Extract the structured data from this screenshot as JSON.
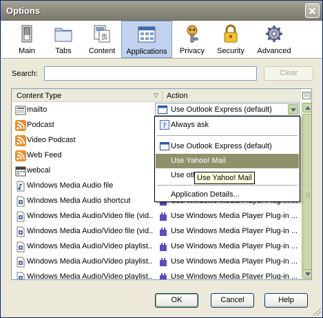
{
  "window": {
    "title": "Options"
  },
  "toolbar": {
    "items": [
      {
        "label": "Main",
        "icon": "switch-icon"
      },
      {
        "label": "Tabs",
        "icon": "folder-tabs-icon"
      },
      {
        "label": "Content",
        "icon": "content-icon"
      },
      {
        "label": "Applications",
        "icon": "applications-icon",
        "selected": true
      },
      {
        "label": "Privacy",
        "icon": "mask-icon"
      },
      {
        "label": "Security",
        "icon": "padlock-icon"
      },
      {
        "label": "Advanced",
        "icon": "gear-icon"
      }
    ]
  },
  "search": {
    "label": "Search:",
    "value": "",
    "clear_label": "Clear"
  },
  "table": {
    "columns": {
      "type": "Content Type",
      "action": "Action"
    },
    "rows": [
      {
        "type": "mailto",
        "icon": "mail-icon",
        "action": "Use Outlook Express (default)"
      },
      {
        "type": "Podcast",
        "icon": "feed-icon",
        "action": ""
      },
      {
        "type": "Video Podcast",
        "icon": "feed-icon",
        "action": ""
      },
      {
        "type": "Web Feed",
        "icon": "feed-icon",
        "action": ""
      },
      {
        "type": "webcal",
        "icon": "calendar-icon",
        "action": ""
      },
      {
        "type": "Windows Media Audio file",
        "icon": "audio-file-icon",
        "action": ""
      },
      {
        "type": "Windows Media Audio shortcut",
        "icon": "media-file-icon",
        "action": "Use Windows Media Player Plug-in ..."
      },
      {
        "type": "Windows Media Audio/Video file (vid...",
        "icon": "media-file-icon",
        "action": "Use Windows Media Player Plug-in ..."
      },
      {
        "type": "Windows Media Audio/Video file (vid...",
        "icon": "media-file-icon",
        "action": "Use Windows Media Player Plug-in ..."
      },
      {
        "type": "Windows Media Audio/Video playlist...",
        "icon": "media-file-icon",
        "action": "Use Windows Media Player Plug-in ..."
      },
      {
        "type": "Windows Media Audio/Video playlist...",
        "icon": "media-file-icon",
        "action": "Use Windows Media Player Plug-in ..."
      },
      {
        "type": "Windows Media Audio/Video playlist...",
        "icon": "media-file-icon",
        "action": "Use Windows Media Player Plug-in ..."
      }
    ]
  },
  "dropdown": {
    "items": [
      {
        "label": "Always ask",
        "icon": "question-icon"
      },
      {
        "label": "Use Outlook Express (default)",
        "icon": "window-app-icon"
      },
      {
        "label": "Use Yahoo! Mail",
        "highlighted": true
      },
      {
        "label": "Use oth"
      },
      {
        "label": "Application Details..."
      }
    ]
  },
  "tooltip": {
    "text": "Use Yahoo! Mail"
  },
  "buttons": {
    "ok": "OK",
    "cancel": "Cancel",
    "help": "Help"
  },
  "colors": {
    "menu_highlight": "#90916a",
    "toolbar_selected": "#c1d2ee",
    "titlebar": "#8f8d80"
  }
}
